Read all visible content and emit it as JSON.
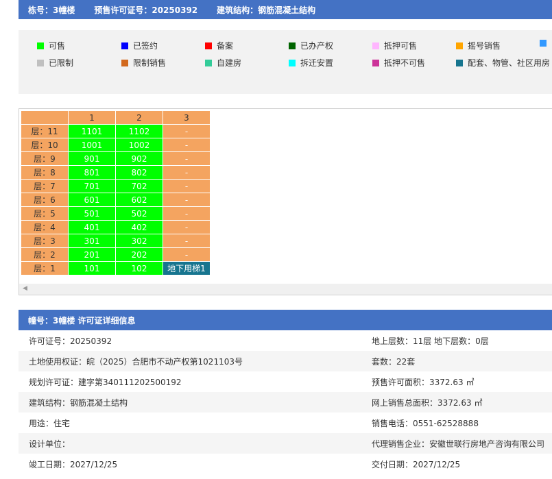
{
  "header": {
    "building": "栋号：3幢楼",
    "permit": "预售许可证号：20250392",
    "structure": "建筑结构：钢筋混凝土结构"
  },
  "legend": [
    {
      "label": "可售",
      "color": "#00ff00"
    },
    {
      "label": "已签约",
      "color": "#0000ff"
    },
    {
      "label": "备案",
      "color": "#ff0000"
    },
    {
      "label": "已办产权",
      "color": "#006400"
    },
    {
      "label": "抵押可售",
      "color": "#ffb6ff"
    },
    {
      "label": "摇号销售",
      "color": "#ffa500"
    },
    {
      "label": "",
      "color": "#3399ff"
    },
    {
      "label": "已限制",
      "color": "#c0c0c0"
    },
    {
      "label": "限制销售",
      "color": "#d2691e"
    },
    {
      "label": "自建房",
      "color": "#33cc99"
    },
    {
      "label": "拆迁安置",
      "color": "#00ffff"
    },
    {
      "label": "抵押不可售",
      "color": "#cc3399"
    },
    {
      "label": "配套、物管、社区用房",
      "color": "#17758f"
    }
  ],
  "grid": {
    "columns": [
      "",
      "1",
      "2",
      "3"
    ],
    "rows": [
      {
        "floor": "层：11",
        "units": [
          "1101",
          "1102",
          "-"
        ]
      },
      {
        "floor": "层：10",
        "units": [
          "1001",
          "1002",
          "-"
        ]
      },
      {
        "floor": "层：9",
        "units": [
          "901",
          "902",
          "-"
        ]
      },
      {
        "floor": "层：8",
        "units": [
          "801",
          "802",
          "-"
        ]
      },
      {
        "floor": "层：7",
        "units": [
          "701",
          "702",
          "-"
        ]
      },
      {
        "floor": "层：6",
        "units": [
          "601",
          "602",
          "-"
        ]
      },
      {
        "floor": "层：5",
        "units": [
          "501",
          "502",
          "-"
        ]
      },
      {
        "floor": "层：4",
        "units": [
          "401",
          "402",
          "-"
        ]
      },
      {
        "floor": "层：3",
        "units": [
          "301",
          "302",
          "-"
        ]
      },
      {
        "floor": "层：2",
        "units": [
          "201",
          "202",
          "-"
        ]
      },
      {
        "floor": "层：1",
        "units": [
          "101",
          "102",
          "地下用梯1"
        ]
      }
    ]
  },
  "detail": {
    "title": "幢号：3幢楼 许可证详细信息",
    "rows": [
      {
        "left": "许可证号：20250392",
        "right": "地上层数：11层  地下层数：0层"
      },
      {
        "left": "土地使用权证：皖（2025）合肥市不动产权第1021103号",
        "right": "套数：22套"
      },
      {
        "left": "规划许可证：建字第340111202500192",
        "right": "预售许可面积：3372.63 ㎡"
      },
      {
        "left": "建筑结构：钢筋混凝土结构",
        "right": "网上销售总面积：3372.63 ㎡"
      },
      {
        "left": "用途：住宅",
        "right": "销售电话：0551-62528888"
      },
      {
        "left": "设计单位：",
        "right": "代理销售企业：安徽世联行房地产咨询有限公司"
      },
      {
        "left": "竣工日期：2027/12/25",
        "right": "交付日期：2027/12/25"
      }
    ]
  }
}
